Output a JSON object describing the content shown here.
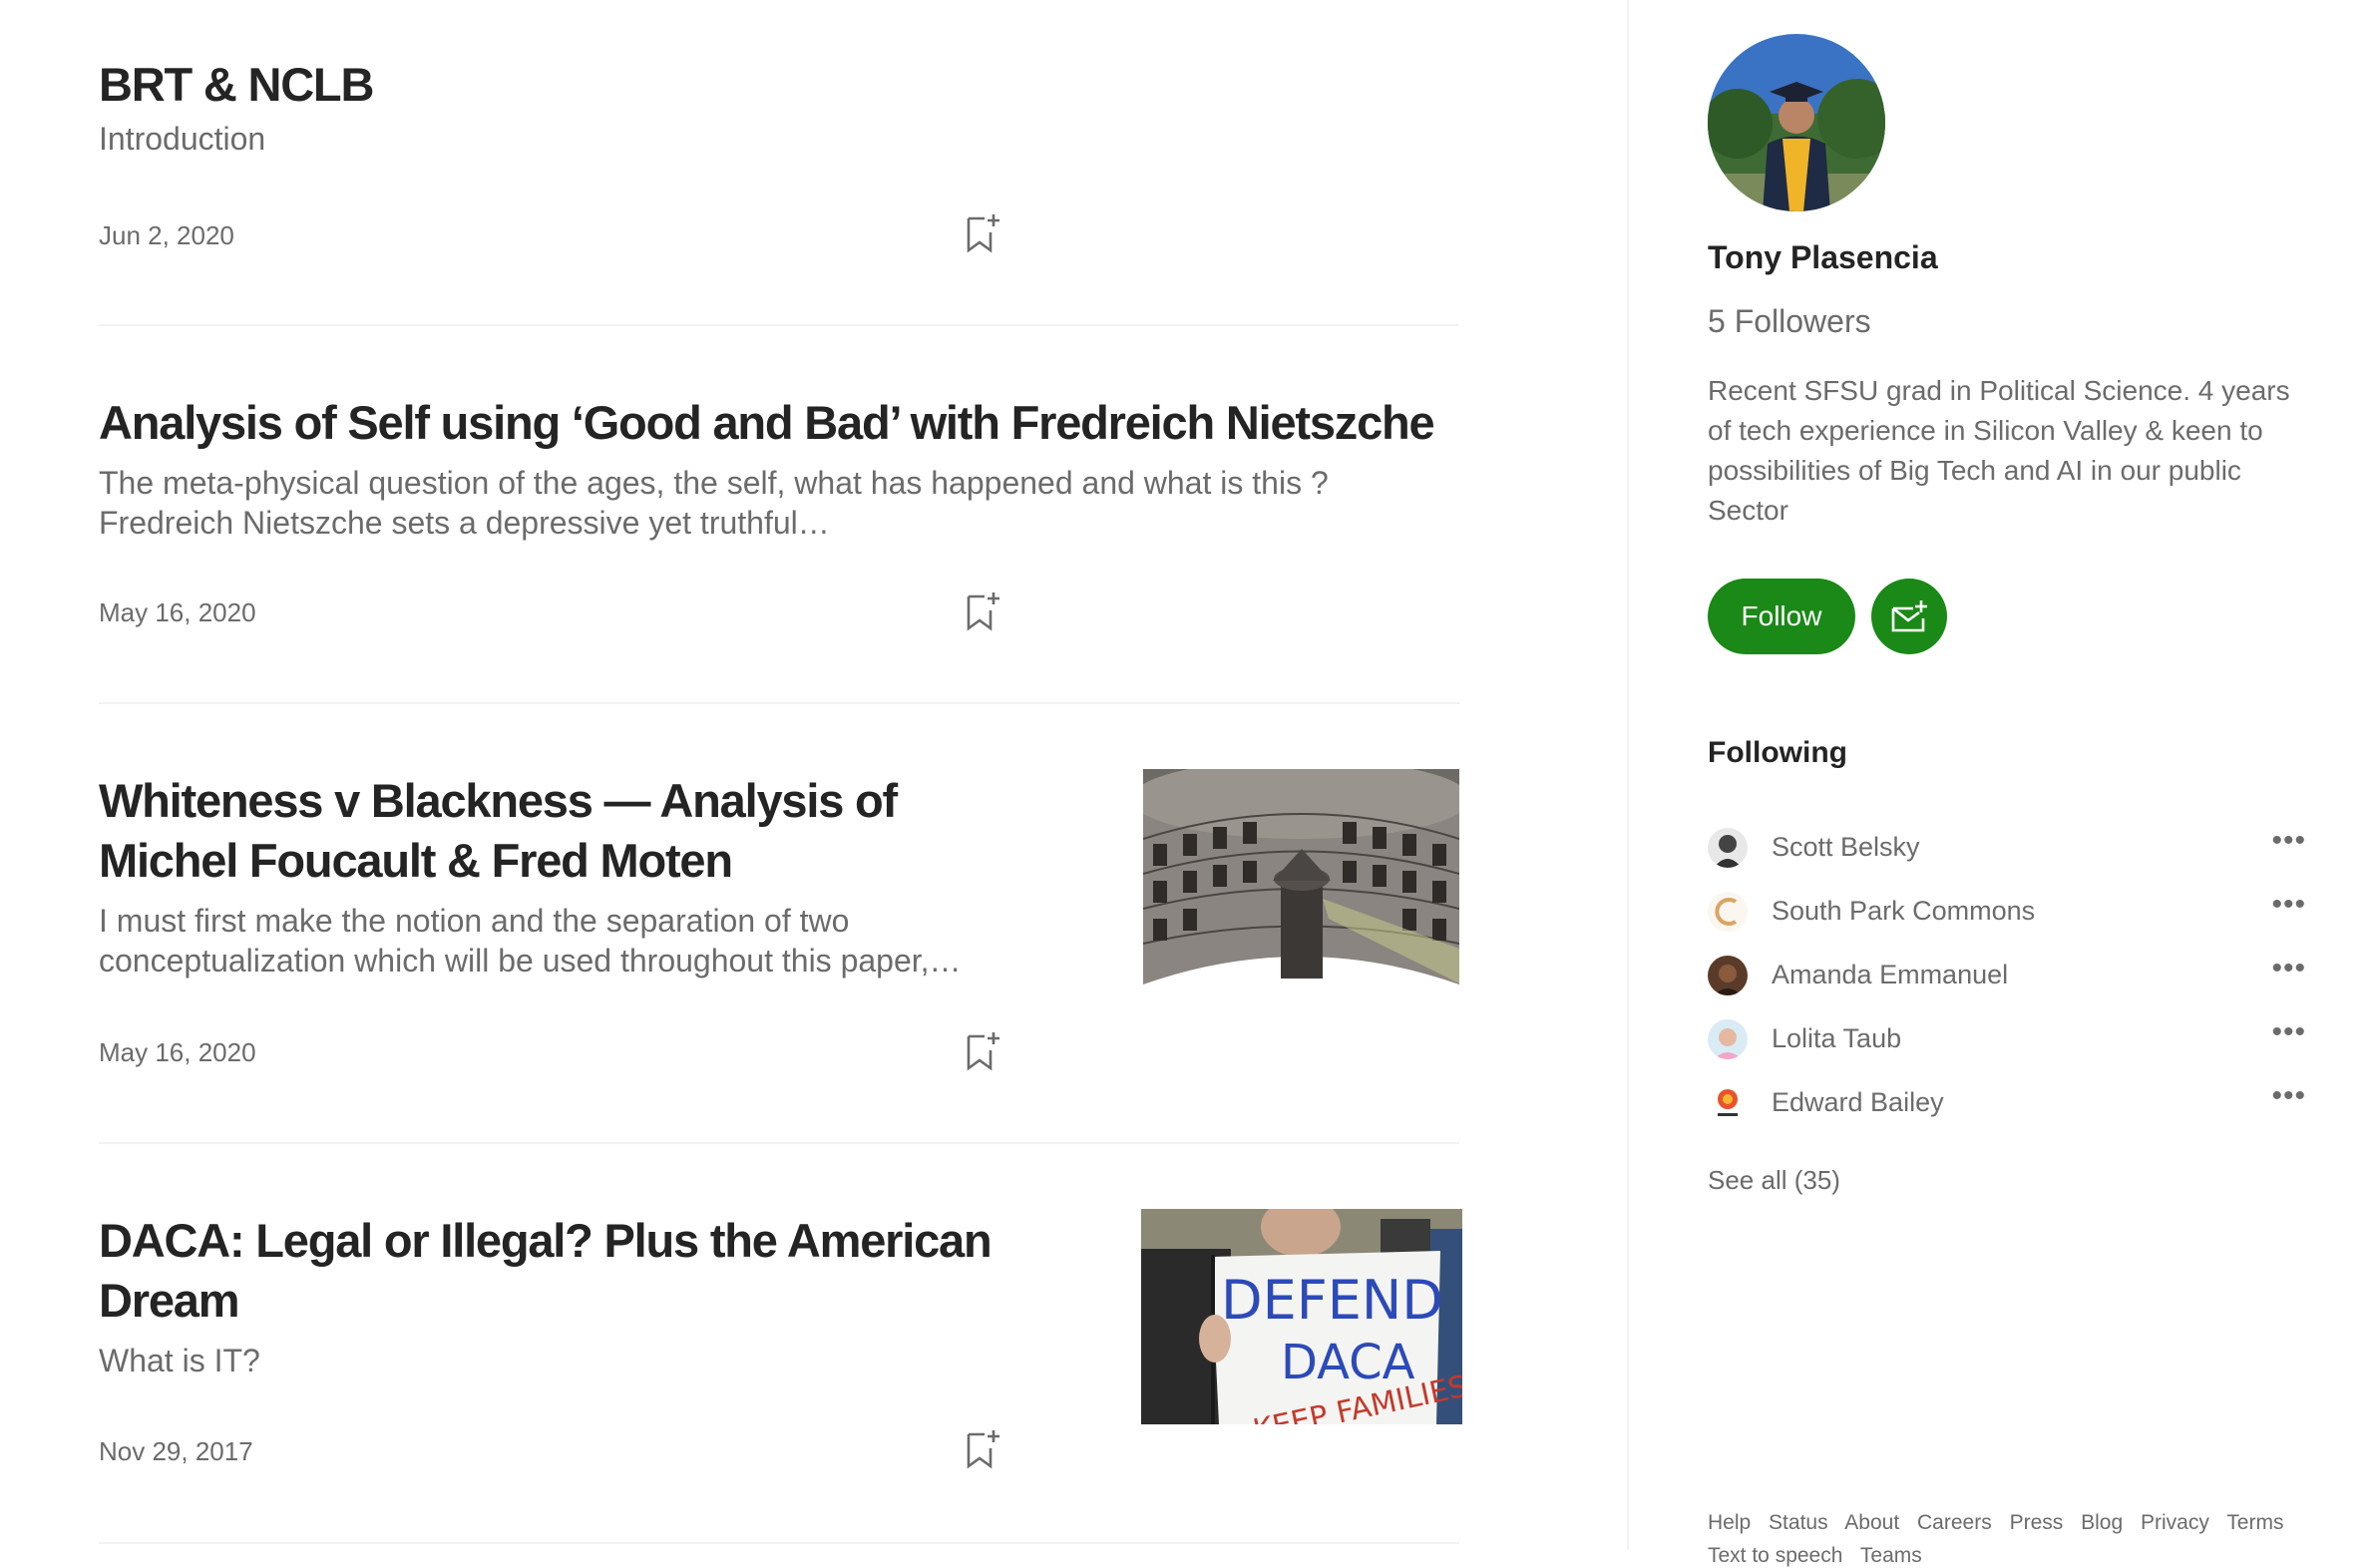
{
  "articles": [
    {
      "title": "BRT & NCLB",
      "subtitle": "Introduction",
      "date": "Jun 2, 2020"
    },
    {
      "title": "Analysis of Self using ‘Good and Bad’ with Fredreich Nietszche",
      "subtitle": "The meta-physical question of the ages, the self, what has happened and what is this ? Fredreich Nietszche sets a depressive yet truthful…",
      "date": "May 16, 2020"
    },
    {
      "title": "Whiteness v Blackness — Analysis of Michel Foucault & Fred Moten",
      "subtitle": "I must first make the notion and the separation of two conceptualization which will be used throughout this paper,…",
      "date": "May 16, 2020"
    },
    {
      "title": "DACA: Legal or Illegal? Plus the American Dream",
      "subtitle": "What is IT?",
      "date": "Nov 29, 2017"
    }
  ],
  "daca_sign": {
    "line1": "DEFEND",
    "line2": "DACA",
    "line3": "KEEP FAMILIES"
  },
  "sidebar": {
    "author_name": "Tony Plasencia",
    "followers": "5 Followers",
    "bio": "Recent SFSU grad in Political Science. 4 years of tech experience in Silicon Valley & keen to possibilities of Big Tech and AI in our public Sector",
    "follow_label": "Follow",
    "following_heading": "Following",
    "following": [
      {
        "name": "Scott Belsky"
      },
      {
        "name": "South Park Commons"
      },
      {
        "name": "Amanda Emmanuel"
      },
      {
        "name": "Lolita Taub"
      },
      {
        "name": "Edward Bailey"
      }
    ],
    "more_label": "•••",
    "see_all": "See all (35)",
    "footer_links": [
      "Help",
      "Status",
      "About",
      "Careers",
      "Press",
      "Blog",
      "Privacy",
      "Terms"
    ],
    "footer_links_2": [
      "Text to speech",
      "Teams"
    ]
  },
  "colors": {
    "accent_green": "#1a8917",
    "text_primary": "#242424",
    "text_secondary": "#6b6b6b"
  }
}
